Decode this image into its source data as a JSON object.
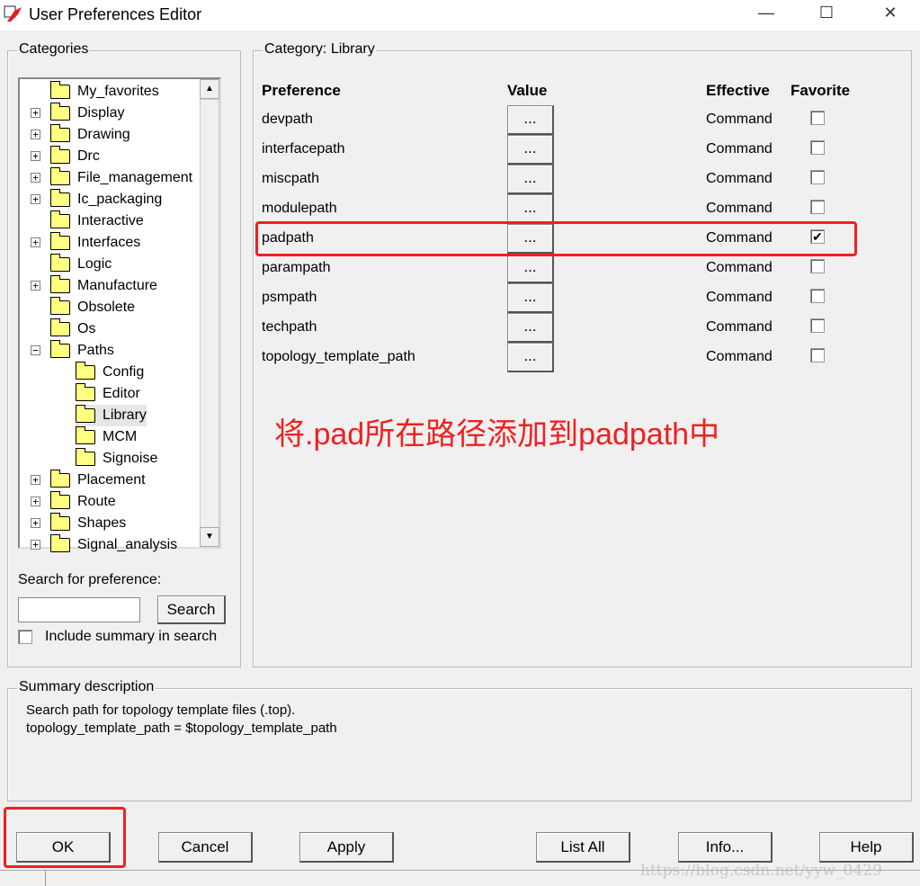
{
  "window": {
    "title": "User Preferences Editor",
    "minimize": "—",
    "maximize": "☐",
    "close": "✕"
  },
  "categories": {
    "label": "Categories",
    "items": [
      {
        "label": "My_favorites",
        "level": 0,
        "expander": ""
      },
      {
        "label": "Display",
        "level": 0,
        "expander": "+"
      },
      {
        "label": "Drawing",
        "level": 0,
        "expander": "+"
      },
      {
        "label": "Drc",
        "level": 0,
        "expander": "+"
      },
      {
        "label": "File_management",
        "level": 0,
        "expander": "+"
      },
      {
        "label": "Ic_packaging",
        "level": 0,
        "expander": "+"
      },
      {
        "label": "Interactive",
        "level": 0,
        "expander": ""
      },
      {
        "label": "Interfaces",
        "level": 0,
        "expander": "+"
      },
      {
        "label": "Logic",
        "level": 0,
        "expander": ""
      },
      {
        "label": "Manufacture",
        "level": 0,
        "expander": "+"
      },
      {
        "label": "Obsolete",
        "level": 0,
        "expander": ""
      },
      {
        "label": "Os",
        "level": 0,
        "expander": ""
      },
      {
        "label": "Paths",
        "level": 0,
        "expander": "−"
      },
      {
        "label": "Config",
        "level": 1,
        "expander": ""
      },
      {
        "label": "Editor",
        "level": 1,
        "expander": ""
      },
      {
        "label": "Library",
        "level": 1,
        "expander": "",
        "selected": true
      },
      {
        "label": "MCM",
        "level": 1,
        "expander": ""
      },
      {
        "label": "Signoise",
        "level": 1,
        "expander": ""
      },
      {
        "label": "Placement",
        "level": 0,
        "expander": "+"
      },
      {
        "label": "Route",
        "level": 0,
        "expander": "+"
      },
      {
        "label": "Shapes",
        "level": 0,
        "expander": "+"
      },
      {
        "label": "Signal_analysis",
        "level": 0,
        "expander": "+"
      }
    ]
  },
  "search": {
    "label": "Search for preference:",
    "value": "",
    "button": "Search",
    "include_summary": "Include summary in search",
    "include_checked": false
  },
  "category_panel": {
    "label": "Category:  Library",
    "headers": {
      "preference": "Preference",
      "value": "Value",
      "effective": "Effective",
      "favorite": "Favorite"
    },
    "rows": [
      {
        "name": "devpath",
        "value": "...",
        "effective": "Command",
        "favorite": false
      },
      {
        "name": "interfacepath",
        "value": "...",
        "effective": "Command",
        "favorite": false
      },
      {
        "name": "miscpath",
        "value": "...",
        "effective": "Command",
        "favorite": false
      },
      {
        "name": "modulepath",
        "value": "...",
        "effective": "Command",
        "favorite": false
      },
      {
        "name": "padpath",
        "value": "...",
        "effective": "Command",
        "favorite": true
      },
      {
        "name": "parampath",
        "value": "...",
        "effective": "Command",
        "favorite": false
      },
      {
        "name": "psmpath",
        "value": "...",
        "effective": "Command",
        "favorite": false
      },
      {
        "name": "techpath",
        "value": "...",
        "effective": "Command",
        "favorite": false
      },
      {
        "name": "topology_template_path",
        "value": "...",
        "effective": "Command",
        "favorite": false
      }
    ]
  },
  "annotation": "将.pad所在路径添加到padpath中",
  "summary": {
    "label": "Summary description",
    "line1": "Search path for topology template files (.top).",
    "line2": "topology_template_path = $topology_template_path"
  },
  "buttons": {
    "ok": "OK",
    "cancel": "Cancel",
    "apply": "Apply",
    "list_all": "List All",
    "info": "Info...",
    "help": "Help"
  },
  "watermark": "https://blog.csdn.net/yyw_0429",
  "colors": {
    "highlight": "#f02020",
    "annotation": "#f02020"
  }
}
